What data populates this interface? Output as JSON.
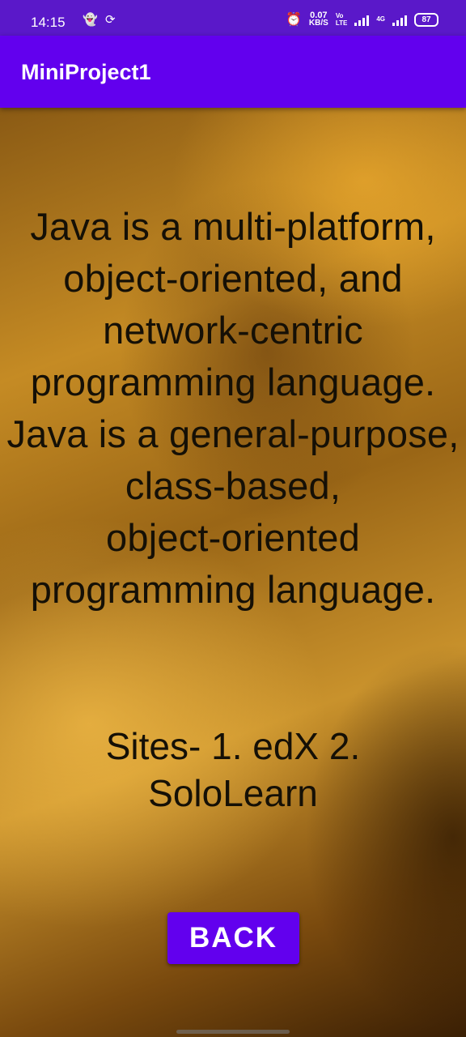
{
  "status_bar": {
    "time": "14:15",
    "speed_value": "0.07",
    "speed_unit": "KB/S",
    "volte_top": "Vo",
    "volte_bottom": "LTE",
    "network": "4G",
    "battery": "87"
  },
  "app_bar": {
    "title": "MiniProject1",
    "color": "#6200ee"
  },
  "content": {
    "description_lines": [
      "Java is a multi-platform,",
      "object-oriented, and",
      "network-centric",
      "programming language.",
      "Java is a general-purpose,",
      "class-based,",
      "object-oriented",
      "programming language."
    ],
    "sites_lines": [
      "Sites- 1. edX 2.",
      "SoloLearn"
    ]
  },
  "back_button": {
    "label": "BACK"
  }
}
